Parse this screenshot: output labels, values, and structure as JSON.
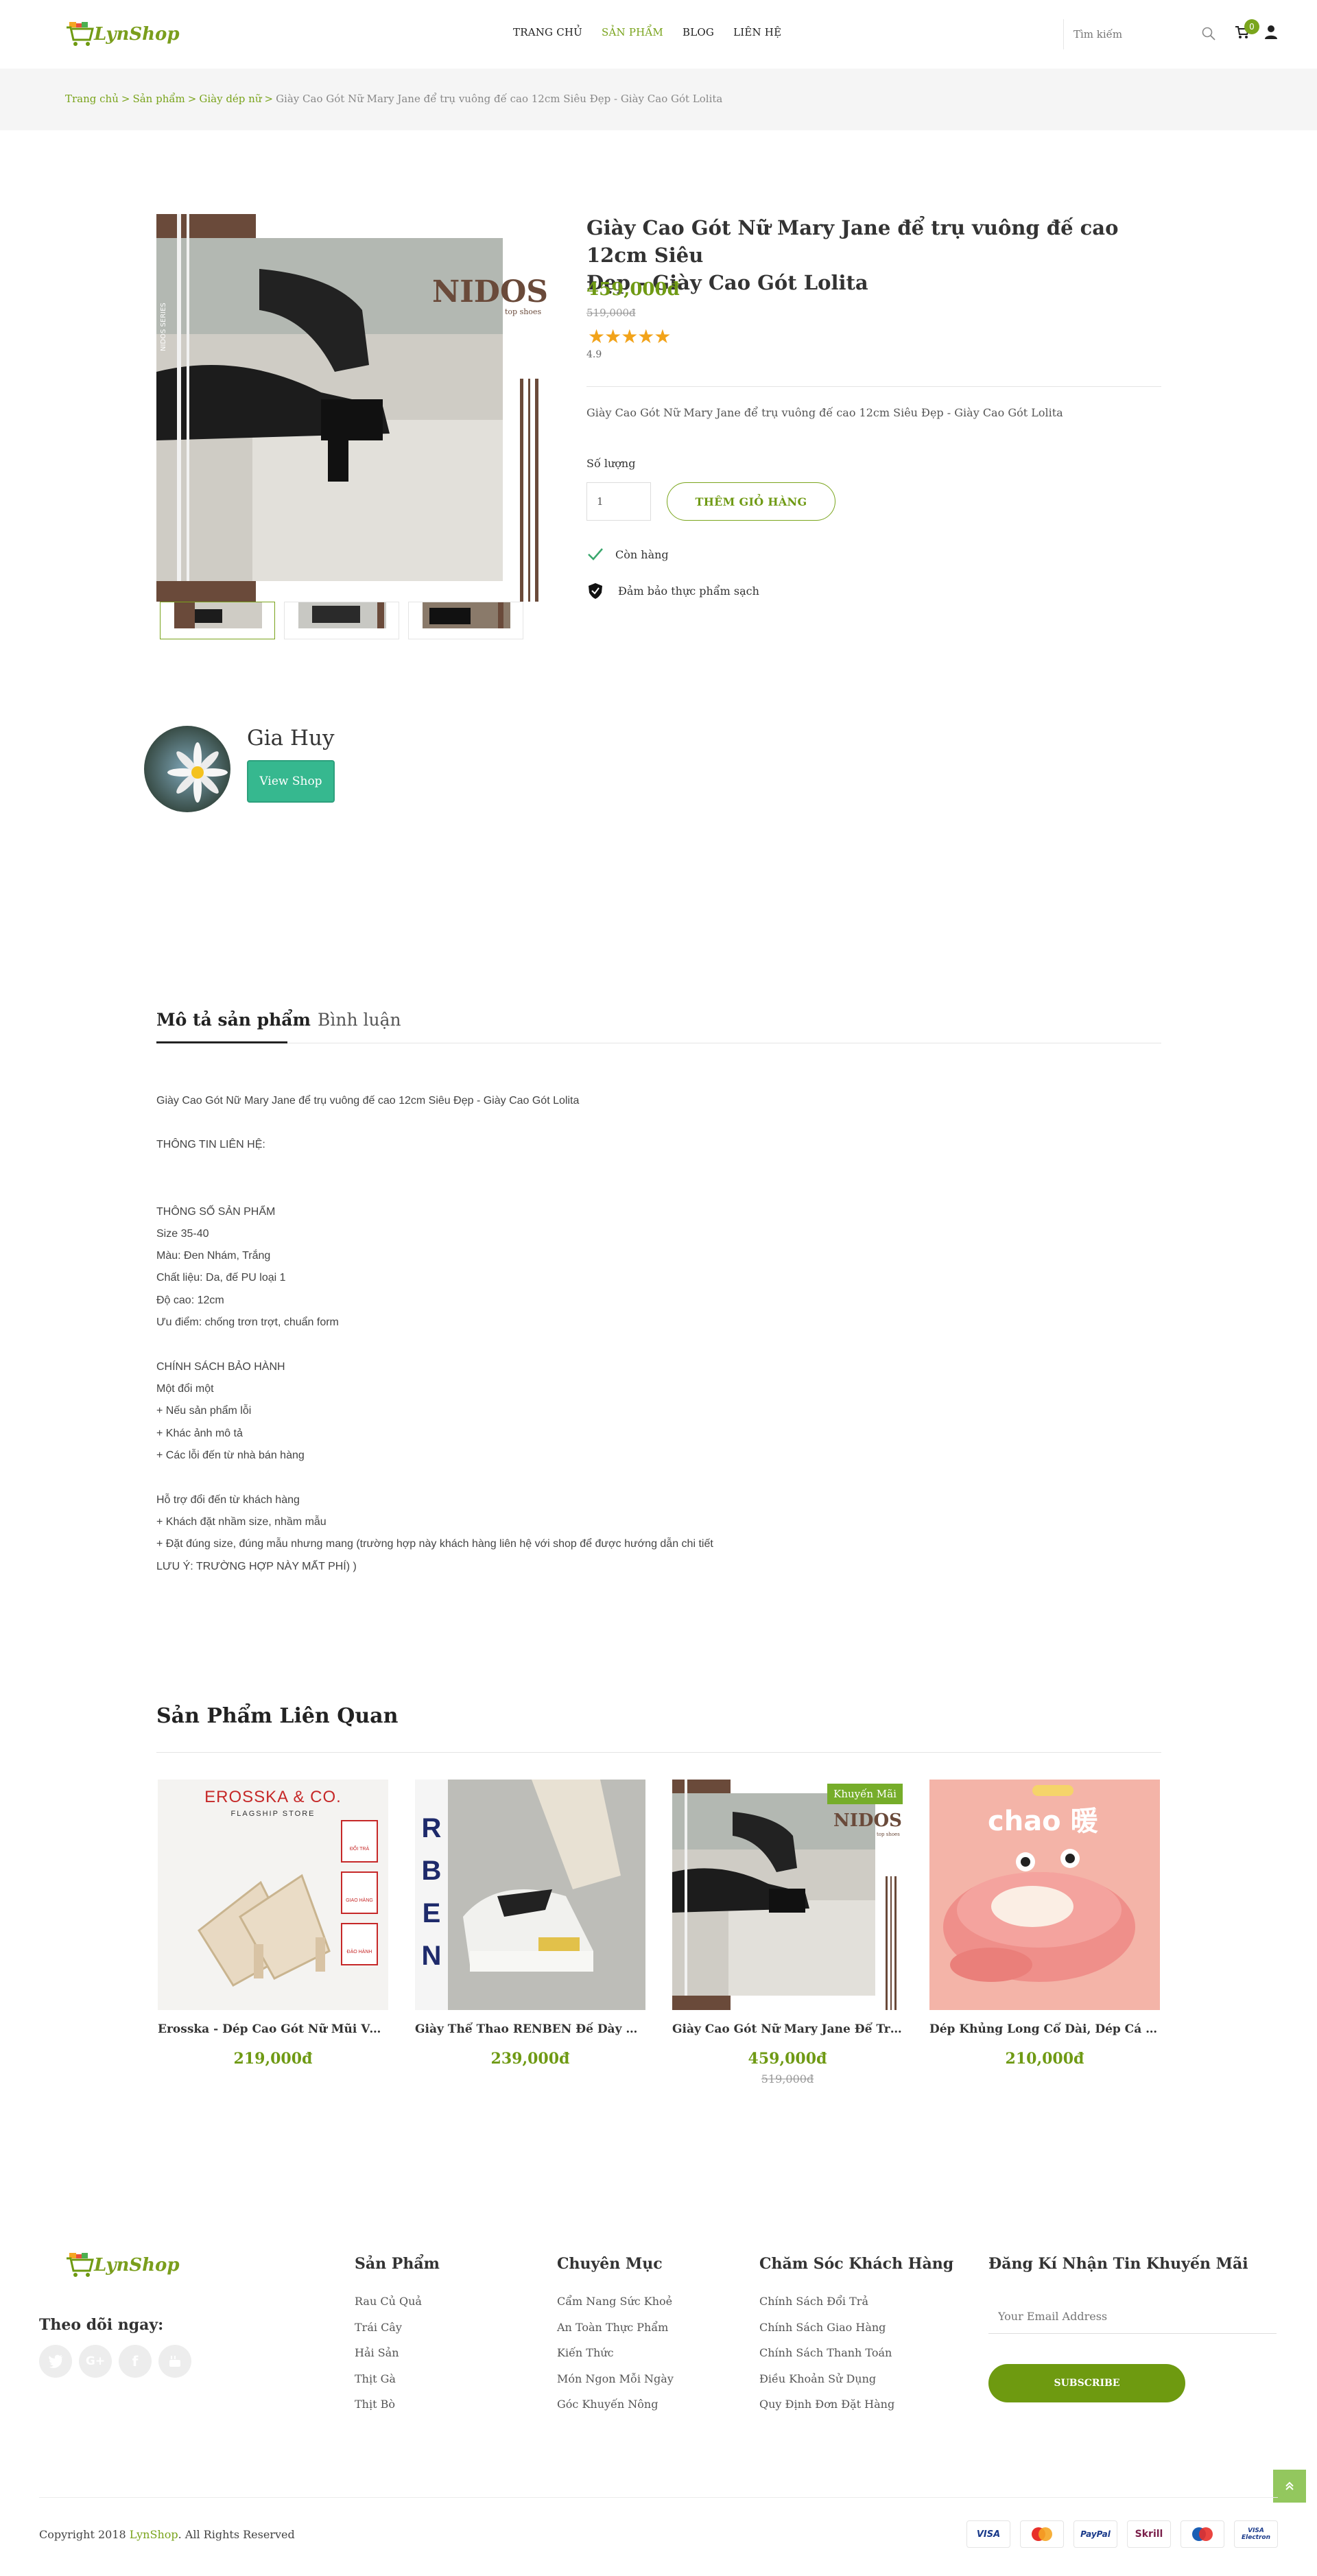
{
  "header": {
    "logo": "LynShop",
    "nav": [
      {
        "label": "TRANG CHỦ",
        "active": false
      },
      {
        "label": "SẢN PHẨM",
        "active": true
      },
      {
        "label": "BLOG",
        "active": false
      },
      {
        "label": "LIÊN HỆ",
        "active": false
      }
    ],
    "search_placeholder": "Tìm kiếm",
    "cart_count": "0"
  },
  "breadcrumb": {
    "items": [
      "Trang chủ",
      "Sản phẩm",
      "Giày dép nữ"
    ],
    "current": "Giày Cao Gót Nữ Mary Jane để trụ vuông đế cao 12cm Siêu Đẹp - Giày Cao Gót Lolita"
  },
  "product": {
    "image_text": {
      "brand": "NIDOS",
      "tagline": "top shoes",
      "series": "NIDOS SERIES"
    },
    "title_line1": "Giày Cao Gót Nữ Mary Jane để trụ vuông đế cao 12cm Siêu",
    "title_line2": "Đẹp - Giày Cao Gót Lolita",
    "price": "459,000đ",
    "old_price": "519,000đ",
    "stars": "★★★★★",
    "rating": "4.9",
    "short_desc": "Giày Cao Gót Nữ Mary Jane để trụ vuông đế cao 12cm Siêu Đẹp - Giày Cao Gót Lolita",
    "qty_label": "Số lượng",
    "qty_value": "1",
    "add_to_cart": "THÊM GIỎ HÀNG",
    "features": [
      "Còn hàng",
      "Đảm bảo thực phẩm sạch"
    ]
  },
  "shop": {
    "name": "Gia Huy",
    "button": "View Shop"
  },
  "tabs": [
    "Mô tả sản phẩm",
    "Bình luận"
  ],
  "description": [
    "Giày Cao Gót Nữ Mary Jane để trụ vuông đế cao 12cm Siêu Đẹp - Giày Cao Gót Lolita",
    " THÔNG TIN LIÊN HỆ:",
    "THÔNG SỐ SẢN PHẨM",
    "Size 35-40",
    "Màu:  Đen Nhám, Trắng",
    "Chất liệu: Da, đế PU loại 1",
    "Độ cao: 12cm",
    "Ưu điểm: chống trơn trợt, chuẩn form",
    "CHÍNH SÁCH BẢO HÀNH",
    "Một đổi một",
    " + Nếu sản phẩm lỗi",
    " + Khác ảnh mô tả",
    " + Các lỗi đến từ nhà bán hàng",
    "Hỗ trợ đổi đến từ khách hàng",
    "+ Khách đặt nhầm size, nhầm mẫu",
    "+ Đặt đúng size, đúng mẫu nhưng mang (trường hợp này khách hàng liên hệ với shop để được hướng dẫn chi tiết",
    "LƯU Ý: TRƯỜNG HỢP NÀY MẤT PHÍ) )"
  ],
  "related": {
    "title": "Sản Phẩm Liên Quan",
    "items": [
      {
        "name": "Erosska - Dép Cao Gót Nữ Mũi Vuông ...",
        "price": "219,000đ",
        "old_price": "",
        "badge": "",
        "img_text": "EROSSKA & CO.",
        "img_sub": "FLAGSHIP STORE",
        "img_tags": [
          "ĐỔI TRẢ",
          "GIAO HÀNG",
          "ĐẢO HÀNH"
        ]
      },
      {
        "name": "Giày Thể Thao RENBEN Đế Dày Đơn G...",
        "price": "239,000đ",
        "old_price": "",
        "badge": "",
        "img_text": "RBEN",
        "img_sub": "",
        "img_tags": []
      },
      {
        "name": "Giày Cao Gót Nữ Mary Jane Để Trụ Vu...",
        "price": "459,000đ",
        "old_price": "519,000đ",
        "badge": "Khuyến Mãi",
        "img_text": "NIDOS",
        "img_sub": "top shoes",
        "img_tags": []
      },
      {
        "name": "Dép Khủng Long Cổ Dài, Dép Cá Sấu Đi...",
        "price": "210,000đ",
        "old_price": "",
        "badge": "",
        "img_text": "chao 暖",
        "img_sub": "",
        "img_tags": []
      }
    ]
  },
  "footer": {
    "logo": "LynShop",
    "follow": "Theo dõi ngay:",
    "social": [
      "twitter-icon",
      "google-plus-icon",
      "facebook-icon",
      "youtube-icon"
    ],
    "columns": [
      {
        "title": "Sản Phẩm",
        "links": [
          "Rau Củ Quả",
          "Trái Cây",
          "Hải Sản",
          "Thịt Gà",
          "Thịt Bò"
        ]
      },
      {
        "title": "Chuyên Mục",
        "links": [
          "Cẩm Nang Sức Khoẻ",
          "An Toàn Thực Phẩm",
          "Kiến Thức",
          "Món Ngon Mỗi Ngày",
          "Góc Khuyến Nông"
        ]
      },
      {
        "title": "Chăm Sóc Khách Hàng",
        "links": [
          "Chính Sách Đổi Trả",
          "Chính Sách Giao Hàng",
          "Chính Sách Thanh Toán",
          "Điều Khoản Sử Dụng",
          "Quy Định Đơn Đặt Hàng"
        ]
      }
    ],
    "newsletter_title": "Đăng Kí Nhận Tin Khuyến Mãi",
    "email_placeholder": "Your Email Address",
    "subscribe": "SUBSCRIBE",
    "copyright_prefix": "Copyright 2018 ",
    "copyright_brand": "LynShop",
    "copyright_suffix": ". All Rights Reserved",
    "payments": [
      "VISA",
      "mastercard",
      "PayPal",
      "Skrill",
      "Maestro",
      "VISA Electron"
    ]
  },
  "colors": {
    "accent": "#79a31b",
    "star": "#f2a31a",
    "shop_button": "#36b88f",
    "subscribe": "#6e9a10"
  }
}
